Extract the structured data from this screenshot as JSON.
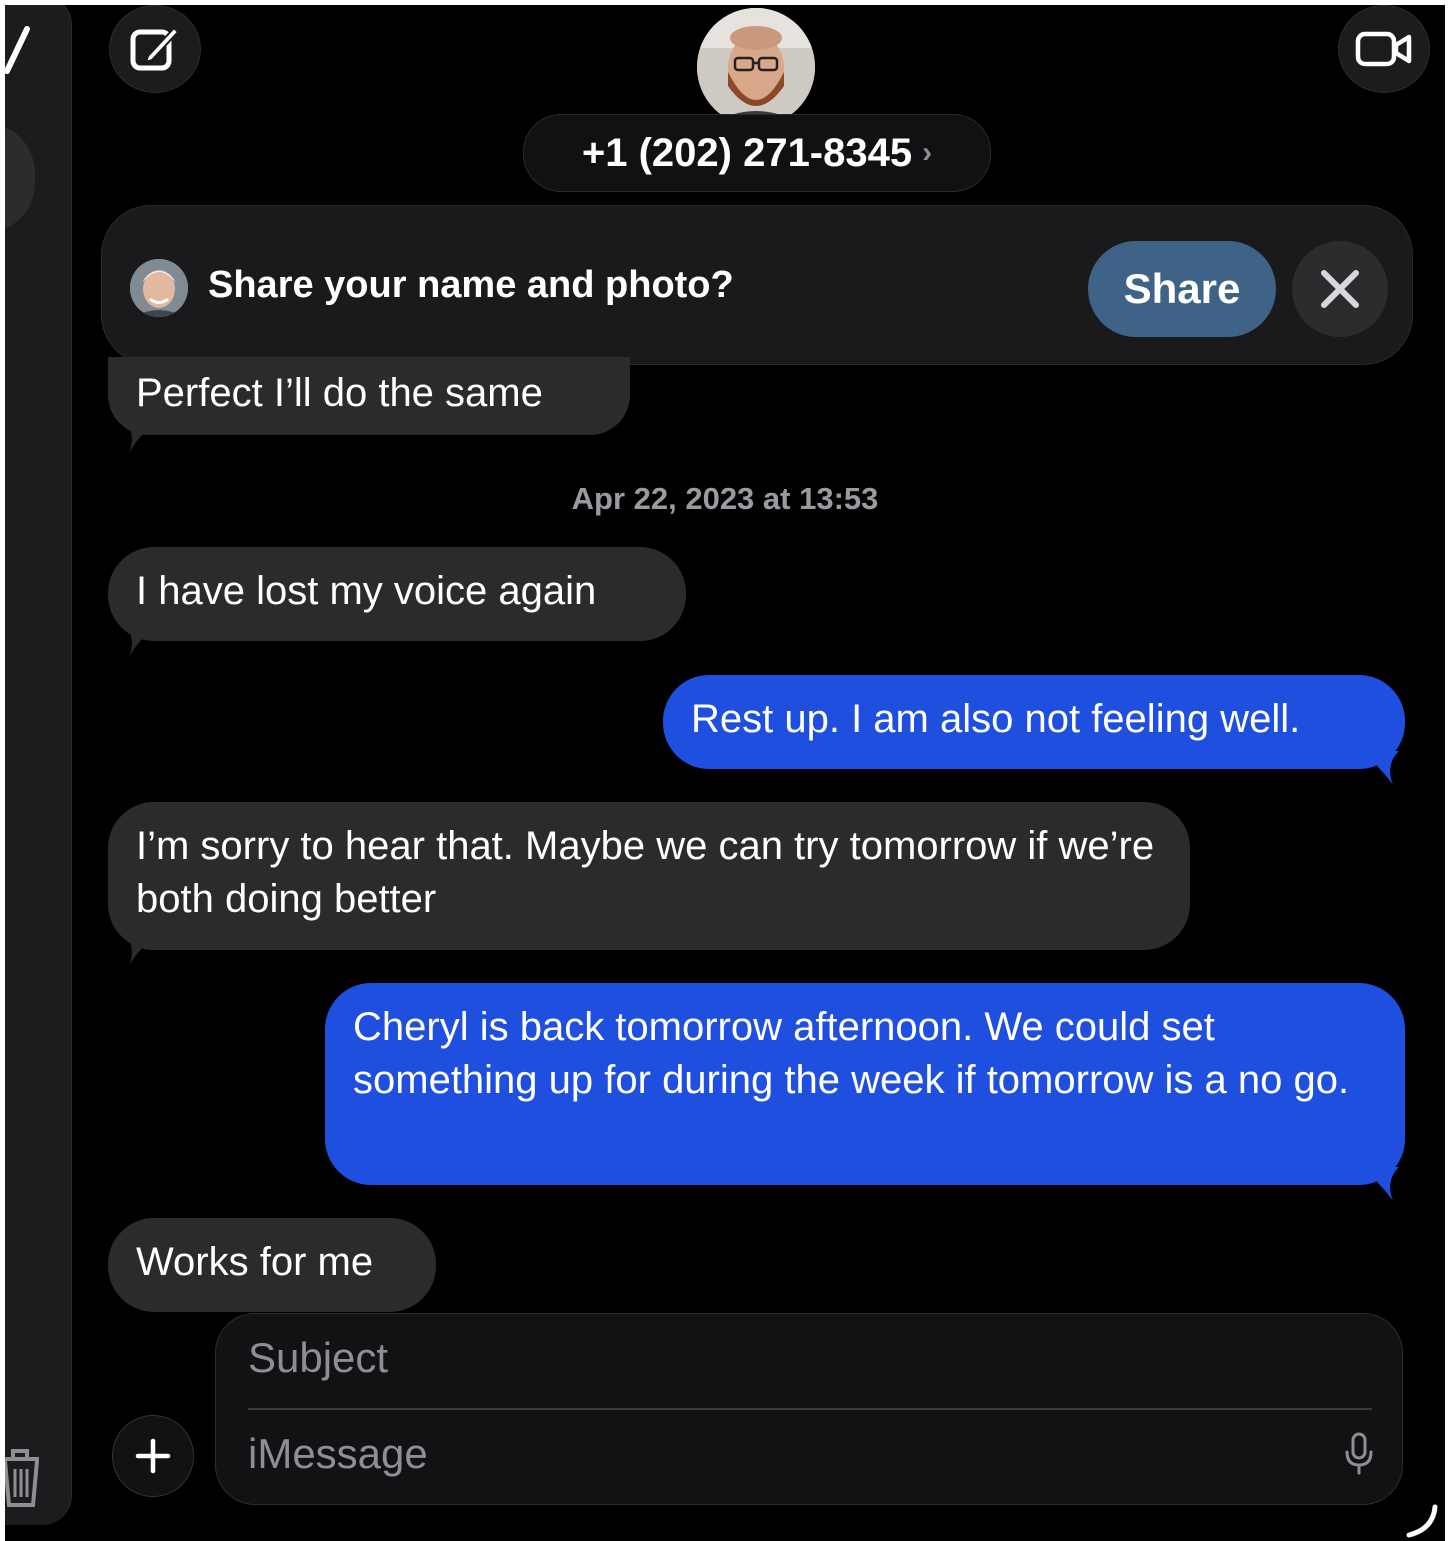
{
  "header": {
    "contact_number": "+1 (202) 271-8345",
    "contact_chevron": "›",
    "compose_icon": "compose-icon",
    "video_icon": "video-camera-icon"
  },
  "banner": {
    "text": "Share your name and photo?",
    "share_label": "Share",
    "close_icon": "close-icon"
  },
  "messages": [
    {
      "direction": "in",
      "text": "Perfect I’ll do the same"
    },
    {
      "direction": "in",
      "text": "I have lost my voice again"
    },
    {
      "direction": "out",
      "text": "Rest up. I am also not feeling well."
    },
    {
      "direction": "in",
      "text": "I’m sorry to hear that. Maybe we can try tomorrow if we’re both doing better"
    },
    {
      "direction": "out",
      "text": "Cheryl is back tomorrow afternoon. We could set something up for during the week if tomorrow is a no go."
    },
    {
      "direction": "in",
      "text": "Works for me"
    }
  ],
  "timestamp": "Apr 22, 2023 at 13:53",
  "composer": {
    "subject_placeholder": "Subject",
    "message_placeholder": "iMessage",
    "plus_icon": "plus-icon",
    "mic_icon": "microphone-icon"
  },
  "colors": {
    "background": "#000000",
    "incoming_bubble": "#2b2b2e",
    "outgoing_bubble": "#1f4fdf",
    "share_button": "#3f6387"
  }
}
